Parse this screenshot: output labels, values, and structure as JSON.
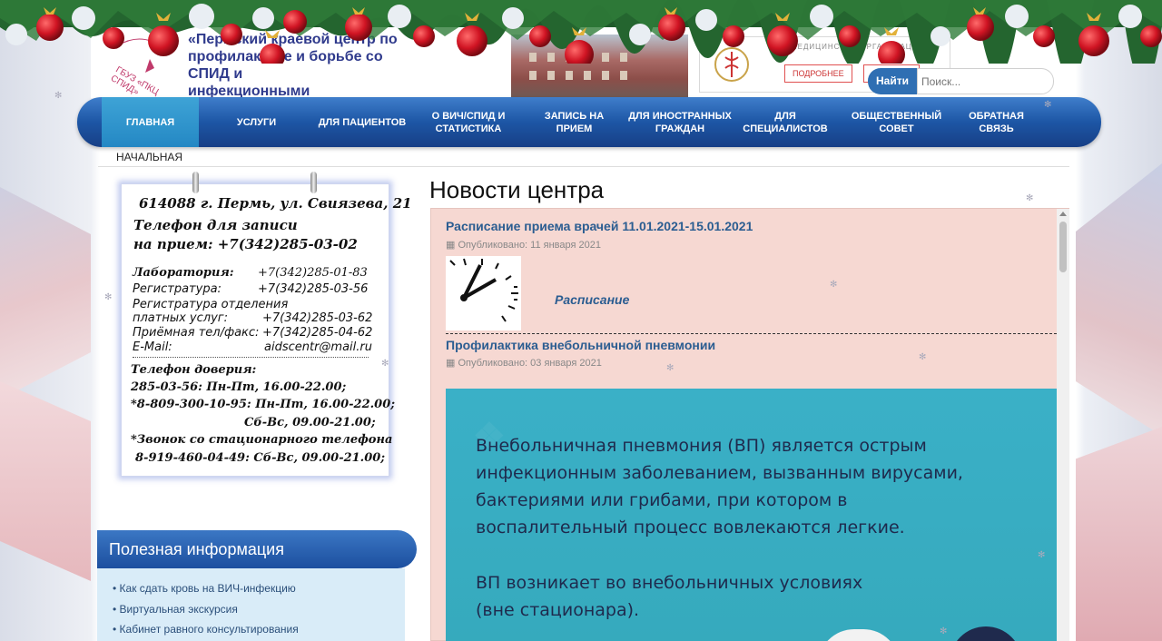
{
  "header": {
    "org_top": "ко",
    "org_name_line1": "«Пермский краевой центр по",
    "org_name_line2": "профилактике и борьбе со СПИД и",
    "org_name_line3": "инфекционными заболеваниями»",
    "logo_text": "ГБУЗ «ПКЦ СПИД»",
    "ministry_label": "МЕДИЦИНСКАЯ ОРГАНИЗАЦИЯ",
    "ministry_btn_more": "ПОДРОБНЕЕ",
    "ministry_btn_rate": "ОЦЕНИТЬ"
  },
  "search": {
    "button_label": "Найти",
    "placeholder": "Поиск..."
  },
  "nav": {
    "items": [
      {
        "label": "Главная"
      },
      {
        "label": "Услуги"
      },
      {
        "label": "Для пациентов"
      },
      {
        "label": "О ВИЧ/СПИД и статистика"
      },
      {
        "label": "Запись на прием"
      },
      {
        "label": "Для иностранных граждан"
      },
      {
        "label": "Для специалистов"
      },
      {
        "label": "Общественный совет"
      },
      {
        "label": "Обратная связь"
      }
    ]
  },
  "breadcrumb": "НАЧАЛЬНАЯ",
  "contact": {
    "address": "614088 г. Пермь, ул. Свиязева, 21",
    "phone_record_label1": "Телефон для записи",
    "phone_record_label2": "на прием: +7(342)285-03-02",
    "lab_label": "Лаборатория:",
    "lab_phone": "+7(342)285-01-83",
    "reg_label": "Регистратура:",
    "reg_phone": "+7(342)285-03-56",
    "paid_label1": "Регистратура отделения",
    "paid_label2": "платных услуг:",
    "paid_phone": "+7(342)285-03-62",
    "reception_label": "Приёмная тел/факс:",
    "reception_phone": "+7(342)285-04-62",
    "email_label": "E-Mail:",
    "email": "aidscentr@mail.ru",
    "trust_title": "Телефон доверия:",
    "trust_line1": "285-03-56: Пн-Пт, 16.00-22.00;",
    "trust_line2": "*8-809-300-10-95: Пн-Пт, 16.00-22.00;",
    "trust_line3": "Сб-Вс, 09.00-21.00;",
    "trust_line4": "*Звонок со стационарного телефона",
    "trust_line5": "8-919-460-04-49: Сб-Вс, 09.00-21.00;"
  },
  "useful": {
    "title": "Полезная информация",
    "links": [
      "Как сдать кровь на ВИЧ-инфекцию",
      "Виртуальная экскурсия",
      "Кабинет равного консультирования"
    ]
  },
  "news": {
    "title": "Новости центра",
    "items": [
      {
        "title": "Расписание приема врачей 11.01.2021-15.01.2021",
        "published": "Опубликовано: 11 января 2021",
        "link_text": "Расписание"
      },
      {
        "title": "Профилактика внебольничной пневмонии",
        "published": "Опубликовано: 03 января 2021"
      }
    ],
    "banner_para1_l1": "Внебольничная пневмония (ВП) является острым",
    "banner_para1_l2": "инфекционным заболеванием, вызванным вирусами,",
    "banner_para1_l3": "бактериями или грибами, при котором в",
    "banner_para1_l4": "воспалительный процесс вовлекаются легкие.",
    "banner_para2_l1": "ВП возникает во внебольничных условиях",
    "banner_para2_l2": "(вне стационара)."
  },
  "colors": {
    "nav_gradient_top": "#3f7ecb",
    "nav_active": "#2488c4",
    "news_bg": "#f6d8d2",
    "banner_bg": "#3ab0c7",
    "link": "#2b5d91"
  },
  "icons": {
    "calendar": "calendar-icon",
    "bullet": "bullet-icon",
    "snowflake": "snowflake-icon"
  }
}
